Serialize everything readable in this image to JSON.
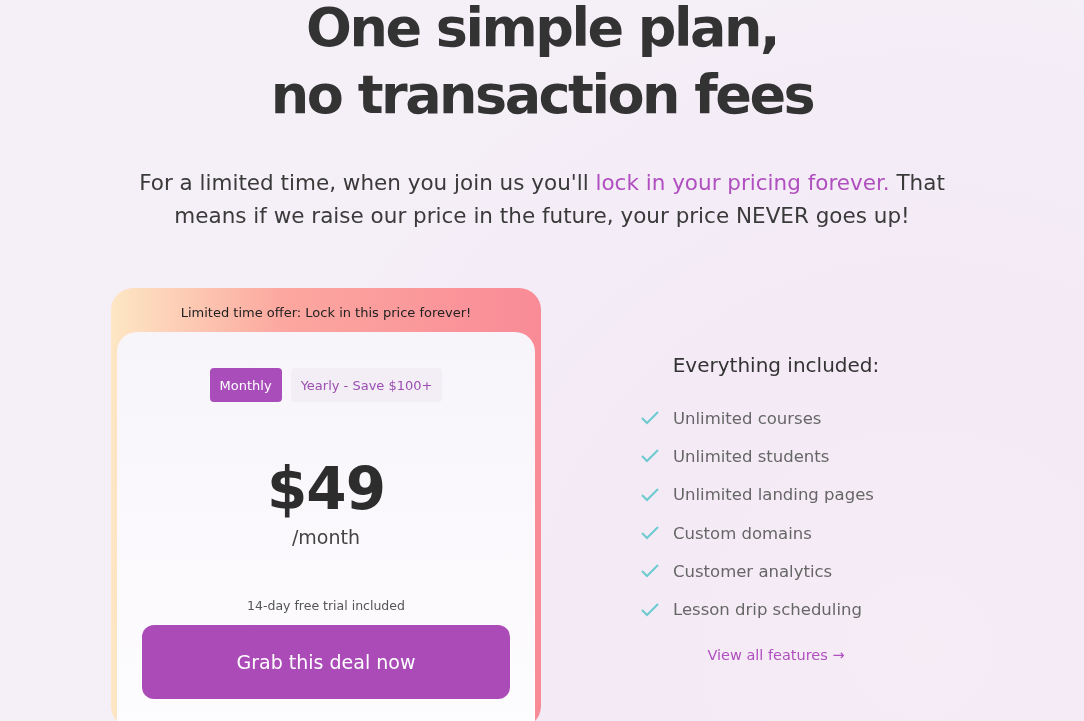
{
  "headline": [
    "One simple plan,",
    "no transaction fees"
  ],
  "subtitle": {
    "before": "For a limited time, when you join us you'll ",
    "link": "lock in your pricing forever.",
    "after": " That means if we raise our price in the future, your price NEVER goes up!"
  },
  "plan_card": {
    "banner": "Limited time offer: Lock in this price forever!",
    "billing_tabs": [
      {
        "label": "Monthly",
        "selected": true
      },
      {
        "label": "Yearly - Save $100+",
        "selected": false
      }
    ],
    "price": "$49",
    "period": "/month",
    "trial_note": "14-day free trial included",
    "cta": "Grab this deal now"
  },
  "features": {
    "title": "Everything included:",
    "items": [
      "Unlimited courses",
      "Unlimited students",
      "Unlimited landing pages",
      "Custom domains",
      "Customer analytics",
      "Lesson drip scheduling"
    ],
    "link": "View all features →"
  }
}
